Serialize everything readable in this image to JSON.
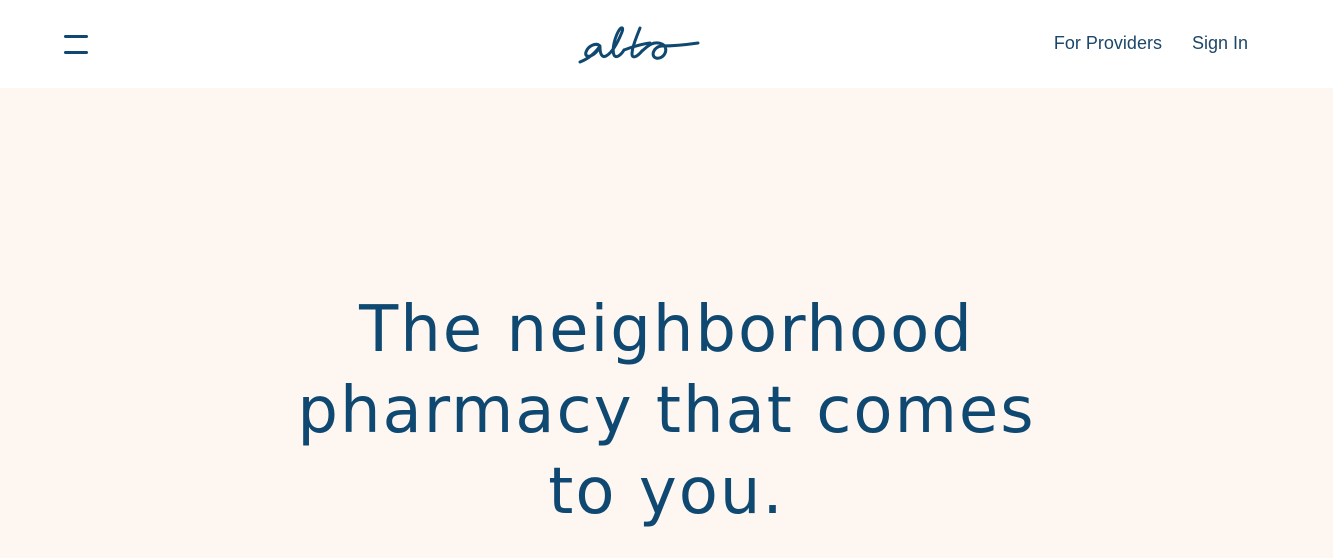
{
  "brand": {
    "logo_text": "alto",
    "primary_color": "#0f4870",
    "hero_background": "#fdf6f1"
  },
  "header": {
    "menu_icon": "hamburger-menu-icon",
    "nav": {
      "for_providers": "For Providers",
      "sign_in": "Sign In"
    }
  },
  "hero": {
    "headline_lines": [
      "The neighborhood",
      "pharmacy that comes",
      "to you."
    ]
  }
}
